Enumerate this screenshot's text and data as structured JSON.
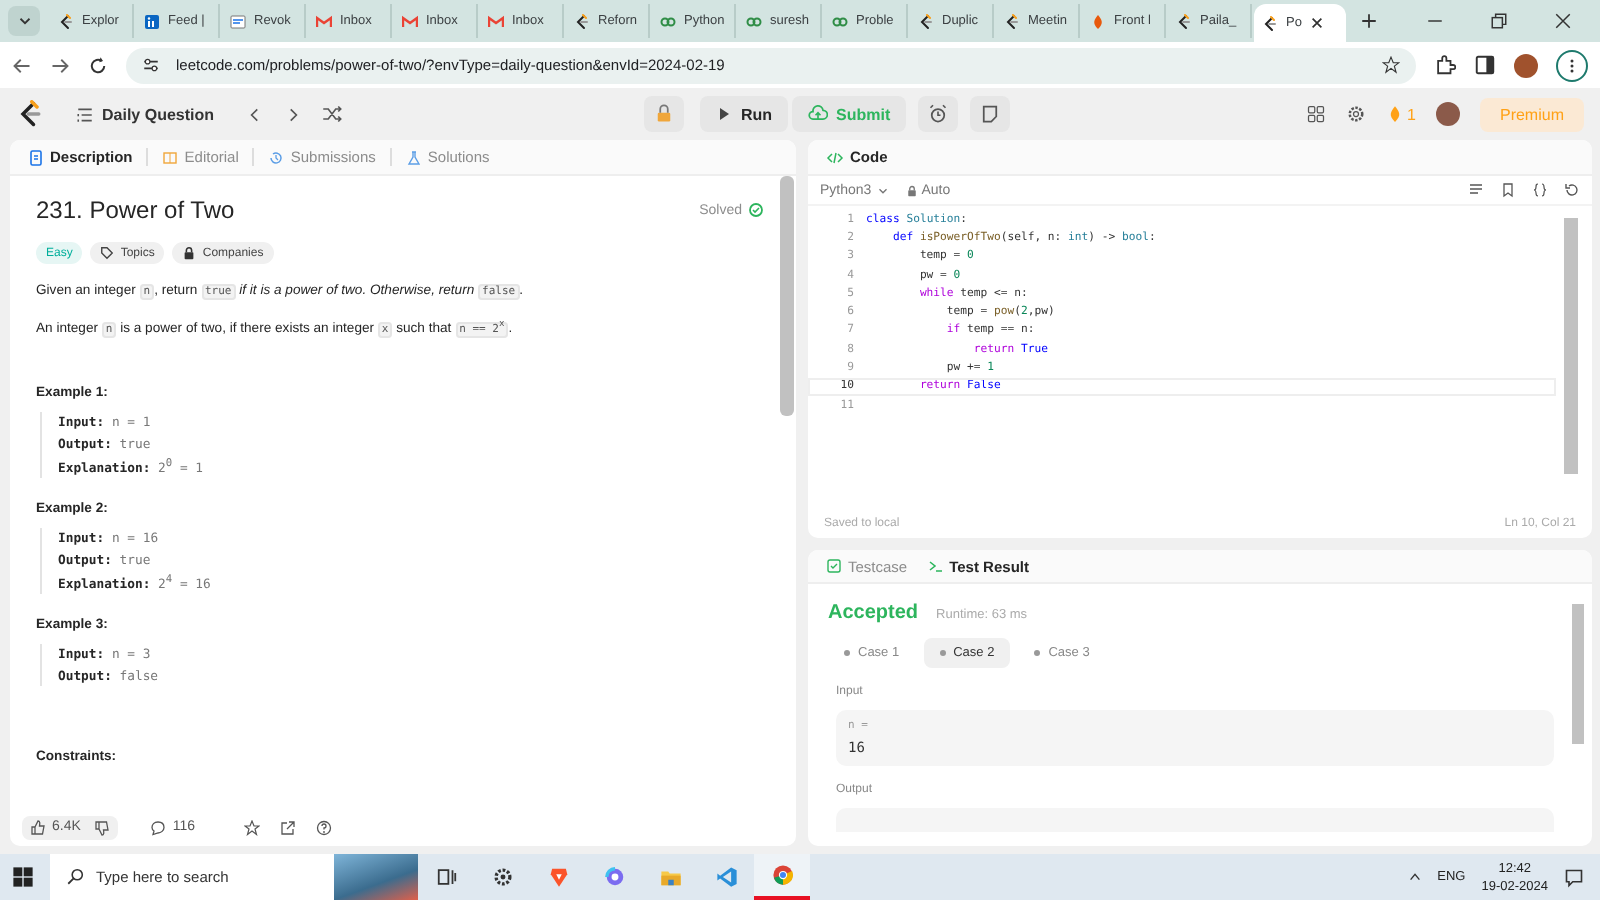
{
  "browser": {
    "tabs": [
      {
        "title": "Explor",
        "kind": "leetcode",
        "selected": false
      },
      {
        "title": "Feed |",
        "kind": "linkedin",
        "selected": false
      },
      {
        "title": "Revok",
        "kind": "doc",
        "selected": false
      },
      {
        "title": "Inbox",
        "kind": "mail",
        "selected": false
      },
      {
        "title": "Inbox",
        "kind": "mail",
        "selected": false
      },
      {
        "title": "Inbox",
        "kind": "mail",
        "selected": false
      },
      {
        "title": "Reforn",
        "kind": "leetcode",
        "selected": false
      },
      {
        "title": "Python",
        "kind": "gfg",
        "selected": false
      },
      {
        "title": "suresh",
        "kind": "gfg",
        "selected": false
      },
      {
        "title": "Proble",
        "kind": "gfg",
        "selected": false
      },
      {
        "title": "Duplic",
        "kind": "leetcode",
        "selected": false
      },
      {
        "title": "Meetin",
        "kind": "leetcode",
        "selected": false
      },
      {
        "title": "Front l",
        "kind": "flame",
        "selected": false
      },
      {
        "title": "Paila_",
        "kind": "leetcode",
        "selected": false
      },
      {
        "title": "Po",
        "kind": "leetcode",
        "selected": true
      }
    ],
    "url": "leetcode.com/problems/power-of-two/?envType=daily-question&envId=2024-02-19"
  },
  "header": {
    "title": "Daily Question",
    "run": "Run",
    "submit": "Submit",
    "streak": "1",
    "premium": "Premium"
  },
  "description": {
    "tabs": [
      {
        "label": "Description",
        "kind": "doc",
        "selected": true
      },
      {
        "label": "Editorial",
        "kind": "book",
        "selected": false
      },
      {
        "label": "Submissions",
        "kind": "history",
        "selected": false
      },
      {
        "label": "Solutions",
        "kind": "flask",
        "selected": false
      }
    ],
    "title": "231. Power of Two",
    "status": "Solved",
    "tags": [
      {
        "label": "Easy",
        "kind": "difficulty"
      },
      {
        "label": "Topics",
        "kind": "topics"
      },
      {
        "label": "Companies",
        "kind": "companies"
      }
    ],
    "paragraphs": [
      [
        {
          "kind": "text",
          "text": "Given an integer "
        },
        {
          "kind": "code",
          "text": "n"
        },
        {
          "kind": "text",
          "text": ", return "
        },
        {
          "kind": "code",
          "text": "true"
        },
        {
          "kind": "italic",
          "text": " if it is a power of two. Otherwise, return "
        },
        {
          "kind": "code",
          "text": "false"
        },
        {
          "kind": "text",
          "text": "."
        }
      ],
      [
        {
          "kind": "text",
          "text": "An integer "
        },
        {
          "kind": "code",
          "text": "n"
        },
        {
          "kind": "text",
          "text": " is a power of two, if there exists an integer "
        },
        {
          "kind": "code",
          "text": "x"
        },
        {
          "kind": "text",
          "text": " such that "
        },
        {
          "kind": "code",
          "text": "n == 2$^{x}$"
        },
        {
          "kind": "text",
          "text": "."
        }
      ]
    ],
    "examples": [
      {
        "title": "Example 1:",
        "lines": [
          {
            "label": "Input:",
            "value": "n = 1"
          },
          {
            "label": "Output:",
            "value": "true"
          },
          {
            "label": "Explanation:",
            "value": "2$^{0}$ = 1"
          }
        ]
      },
      {
        "title": "Example 2:",
        "lines": [
          {
            "label": "Input:",
            "value": "n = 16"
          },
          {
            "label": "Output:",
            "value": "true"
          },
          {
            "label": "Explanation:",
            "value": "2$^{4}$ = 16"
          }
        ]
      },
      {
        "title": "Example 3:",
        "lines": [
          {
            "label": "Input:",
            "value": "n = 3"
          },
          {
            "label": "Output:",
            "value": "false"
          }
        ]
      }
    ],
    "constraints": "Constraints:",
    "likes": "6.4K",
    "comments": "116"
  },
  "editor": {
    "title": "Code",
    "language": "Python3",
    "mode": "Auto",
    "lines": [
      {
        "number": "1",
        "active": false,
        "tokens": [
          {
            "kind": "keyword",
            "text": "class"
          },
          {
            "kind": "type",
            "text": " Solution"
          },
          {
            "kind": "plain",
            "text": ":"
          }
        ]
      },
      {
        "number": "2",
        "active": false,
        "tokens": [
          {
            "kind": "keyword",
            "text": "    def"
          },
          {
            "kind": "function",
            "text": " isPowerOfTwo"
          },
          {
            "kind": "plain",
            "text": "(self, n: "
          },
          {
            "kind": "type",
            "text": "int"
          },
          {
            "kind": "plain",
            "text": ") -> "
          },
          {
            "kind": "type",
            "text": "bool"
          },
          {
            "kind": "plain",
            "text": ":"
          }
        ]
      },
      {
        "number": "3",
        "active": false,
        "tokens": [
          {
            "kind": "plain",
            "text": "        temp = "
          },
          {
            "kind": "number",
            "text": "0"
          }
        ]
      },
      {
        "number": "4",
        "active": false,
        "tokens": [
          {
            "kind": "plain",
            "text": "        pw = "
          },
          {
            "kind": "number",
            "text": "0"
          }
        ]
      },
      {
        "number": "5",
        "active": false,
        "tokens": [
          {
            "kind": "control",
            "text": "        while"
          },
          {
            "kind": "plain",
            "text": " temp <= n:"
          }
        ]
      },
      {
        "number": "6",
        "active": false,
        "tokens": [
          {
            "kind": "plain",
            "text": "            temp = "
          },
          {
            "kind": "function",
            "text": "pow"
          },
          {
            "kind": "plain",
            "text": "("
          },
          {
            "kind": "number",
            "text": "2"
          },
          {
            "kind": "plain",
            "text": ",pw)"
          }
        ]
      },
      {
        "number": "7",
        "active": false,
        "tokens": [
          {
            "kind": "control",
            "text": "            if"
          },
          {
            "kind": "plain",
            "text": " temp == n:"
          }
        ]
      },
      {
        "number": "8",
        "active": false,
        "tokens": [
          {
            "kind": "control",
            "text": "                return"
          },
          {
            "kind": "keyword",
            "text": " True"
          }
        ]
      },
      {
        "number": "9",
        "active": false,
        "tokens": [
          {
            "kind": "plain",
            "text": "            pw += "
          },
          {
            "kind": "number",
            "text": "1"
          }
        ]
      },
      {
        "number": "10",
        "active": true,
        "tokens": [
          {
            "kind": "control",
            "text": "        return"
          },
          {
            "kind": "keyword",
            "text": " False"
          }
        ]
      },
      {
        "number": "11",
        "active": false
      }
    ],
    "saved": "Saved to local",
    "cursor": "Ln 10, Col 21"
  },
  "console": {
    "tabs": [
      {
        "label": "Testcase",
        "kind": "check",
        "selected": false
      },
      {
        "label": "Test Result",
        "kind": "terminal",
        "selected": true
      }
    ],
    "verdict": "Accepted",
    "runtime": "Runtime: 63 ms",
    "cases": [
      {
        "label": "Case 1",
        "selected": false
      },
      {
        "label": "Case 2",
        "selected": true
      },
      {
        "label": "Case 3",
        "selected": false
      }
    ],
    "input_label": "Input",
    "inputs": [
      {
        "name": "n =",
        "value": "16"
      }
    ],
    "output_label": "Output"
  },
  "taskbar": {
    "search_placeholder": "Type here to search",
    "language": "ENG",
    "time": "12:42",
    "date": "19-02-2024"
  }
}
